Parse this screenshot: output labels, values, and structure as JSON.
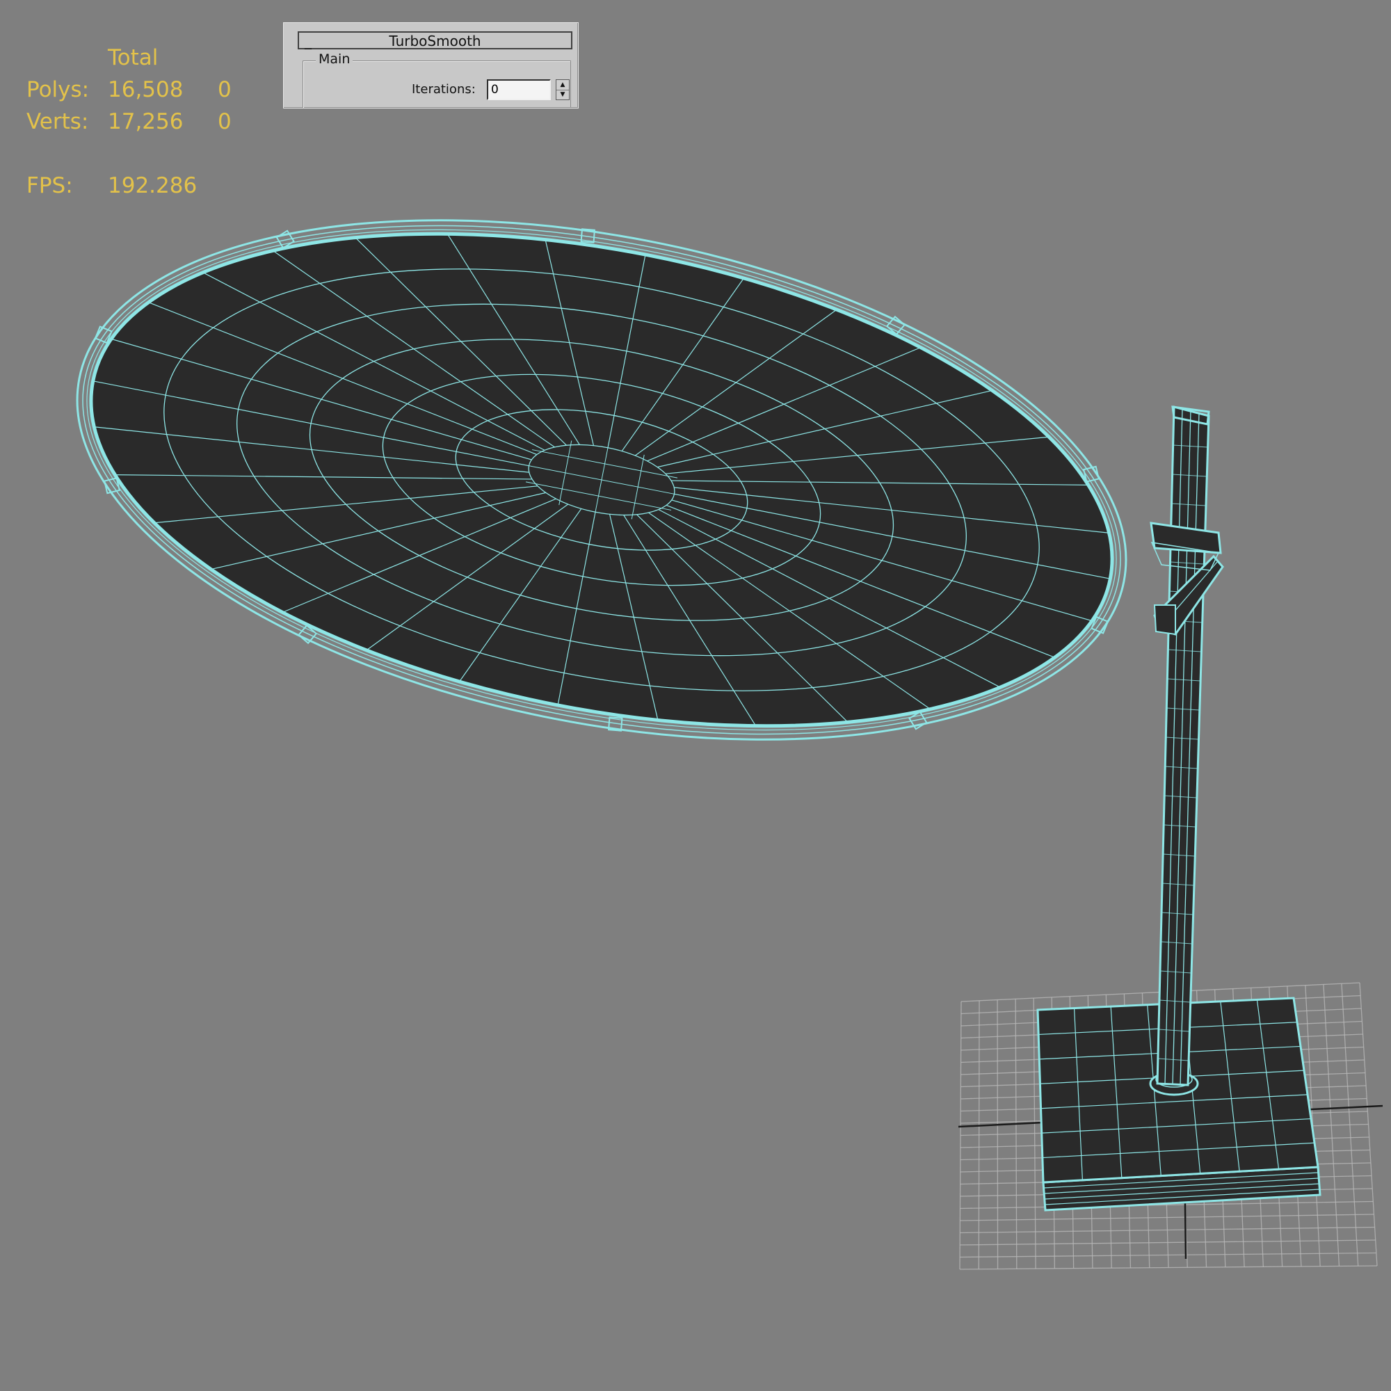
{
  "stats": {
    "header": "Total",
    "rows": [
      {
        "label": "Polys:",
        "total": "16,508",
        "selected": "0"
      },
      {
        "label": "Verts:",
        "total": "17,256",
        "selected": "0"
      }
    ],
    "fps_label": "FPS:",
    "fps_value": "192.286"
  },
  "panel": {
    "collapse": "_",
    "title": "TurboSmooth",
    "group": "Main",
    "iterations_label": "Iterations:",
    "iterations_value": "0"
  },
  "colors": {
    "viewport_bg": "#7f7f7f",
    "wire": "#8ee6e6",
    "mesh_fill": "#2a2a2a",
    "stats_text": "#e3c24a",
    "grid": "#b8b8b8"
  }
}
